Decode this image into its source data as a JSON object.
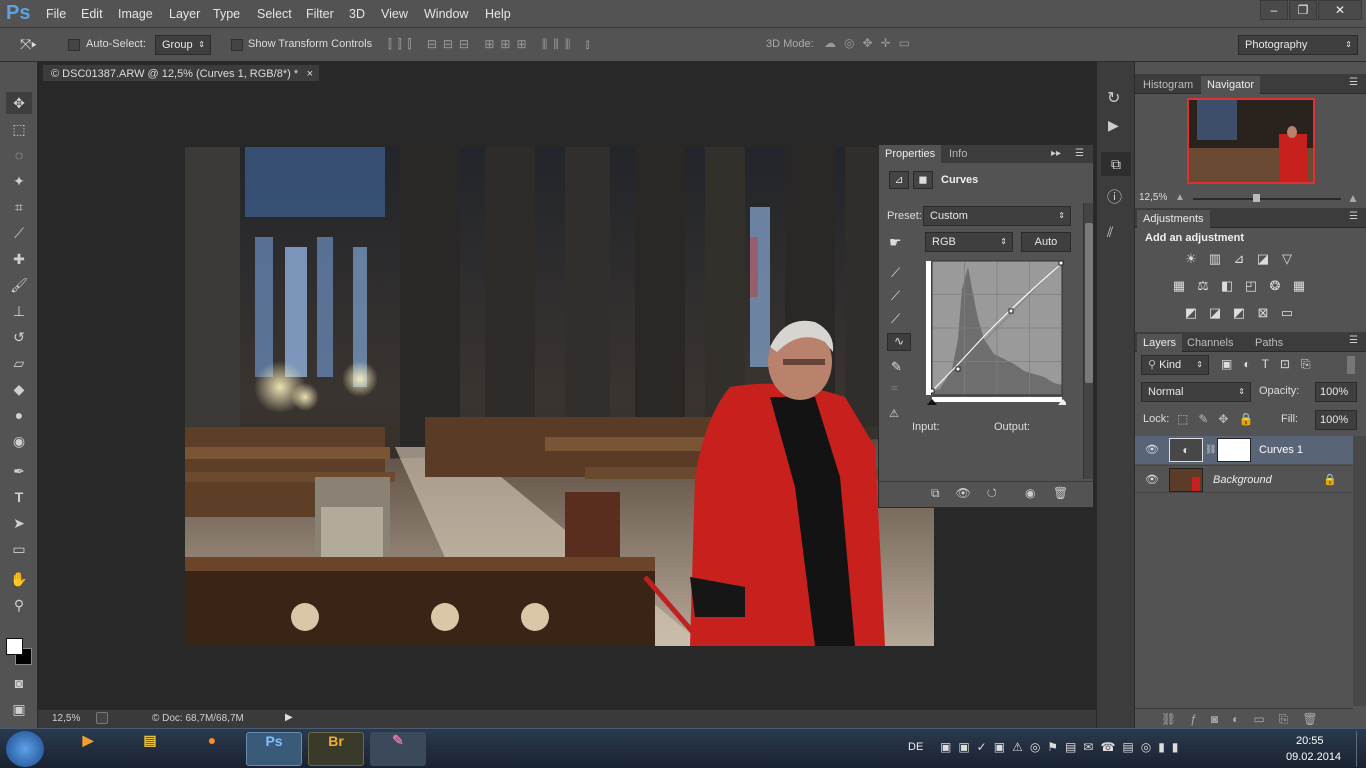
{
  "app": {
    "logo": "Ps",
    "menu": [
      "File",
      "Edit",
      "Image",
      "Layer",
      "Type",
      "Select",
      "Filter",
      "3D",
      "View",
      "Window",
      "Help"
    ]
  },
  "options": {
    "auto_select_label": "Auto-Select:",
    "auto_select_value": "Group",
    "show_transform_label": "Show Transform Controls",
    "mode3d_label": "3D Mode:",
    "workspace": "Photography"
  },
  "document": {
    "tab_title": "© DSC01387.ARW @ 12,5% (Curves 1, RGB/8*) *",
    "close": "×"
  },
  "status": {
    "zoom": "12,5%",
    "doc": "© Doc: 68,7M/68,7M"
  },
  "properties": {
    "tabs": [
      "Properties",
      "Info"
    ],
    "title": "Curves",
    "preset_label": "Preset:",
    "preset_value": "Custom",
    "channel": "RGB",
    "auto_button": "Auto",
    "input_label": "Input:",
    "output_label": "Output:"
  },
  "navigator": {
    "tabs": [
      "Histogram",
      "Navigator"
    ],
    "zoom": "12,5%"
  },
  "adjustments": {
    "tab": "Adjustments",
    "heading": "Add an adjustment"
  },
  "layers": {
    "tabs": [
      "Layers",
      "Channels",
      "Paths"
    ],
    "filter_kind": "Kind",
    "blend_mode": "Normal",
    "opacity_label": "Opacity:",
    "opacity": "100%",
    "lock_label": "Lock:",
    "fill_label": "Fill:",
    "fill": "100%",
    "items": [
      {
        "name": "Curves 1"
      },
      {
        "name": "Background"
      }
    ]
  },
  "taskbar": {
    "lang": "DE",
    "time": "20:55",
    "date": "09.02.2014",
    "apps": [
      "Ps",
      "Br"
    ]
  },
  "colors": {
    "accent": "#5ba3e0",
    "ui": "#535353",
    "canvas": "#282828",
    "red_robe": "#c8201c"
  }
}
